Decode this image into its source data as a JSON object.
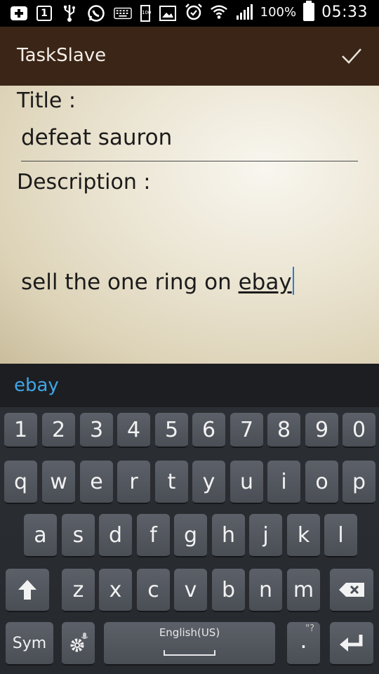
{
  "status_bar": {
    "battery_pct": "100%",
    "time": "05:33",
    "mini_box_label": "1",
    "mini_battery_label": "100",
    "icons_left": [
      "add-icon",
      "notification-number-icon",
      "usb-icon",
      "whatsapp-icon",
      "keyboard-icon",
      "battery-mini-icon",
      "image-icon"
    ],
    "icons_right": [
      "alarm-icon",
      "wifi-icon",
      "signal-icon",
      "battery-icon"
    ]
  },
  "app": {
    "title": "TaskSlave",
    "confirm_icon": "check-icon",
    "bar_color": "#3a2517"
  },
  "form": {
    "title_label": "Title :",
    "title_value": "defeat sauron",
    "description_label": "Description :",
    "description_value_prefix": "sell the one ring on ",
    "description_value_current_word": "ebay"
  },
  "suggestions": {
    "items": [
      "ebay"
    ],
    "color": "#3fa6e8"
  },
  "keyboard": {
    "row_numbers": [
      "1",
      "2",
      "3",
      "4",
      "5",
      "6",
      "7",
      "8",
      "9",
      "0"
    ],
    "row_1": [
      "q",
      "w",
      "e",
      "r",
      "t",
      "y",
      "u",
      "i",
      "o",
      "p"
    ],
    "row_2": [
      "a",
      "s",
      "d",
      "f",
      "g",
      "h",
      "j",
      "k",
      "l"
    ],
    "row_3": [
      "z",
      "x",
      "c",
      "v",
      "b",
      "n",
      "m"
    ],
    "sym_label": "Sym",
    "space_label": "English(US)",
    "punct_hint": "\"?",
    "punct_main": ".",
    "icons": [
      "shift-icon",
      "backspace-icon",
      "settings-icon",
      "enter-icon"
    ]
  }
}
